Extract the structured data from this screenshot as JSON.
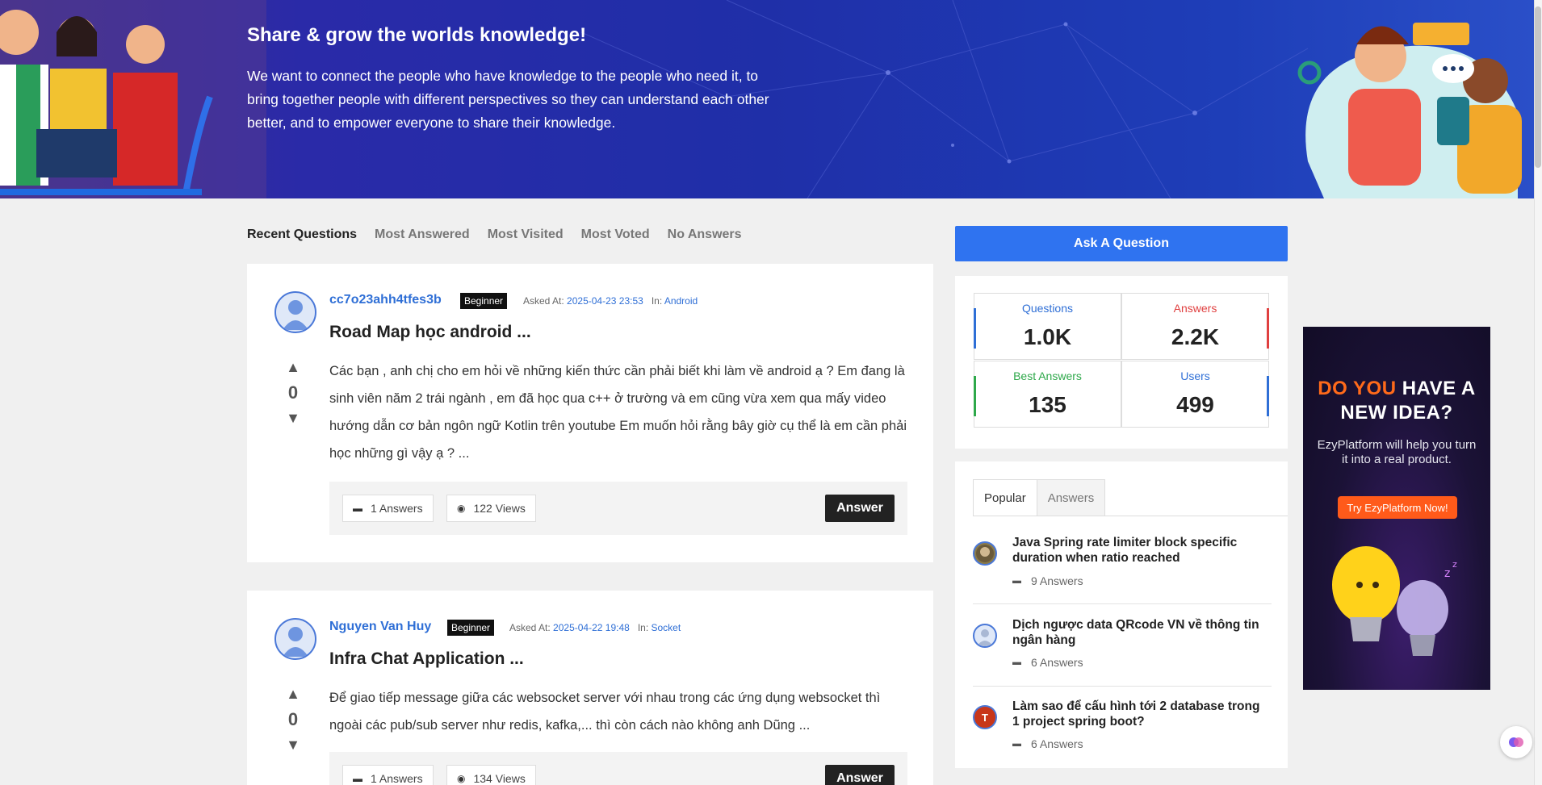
{
  "hero": {
    "title": "Share & grow the worlds knowledge!",
    "text": "We want to connect the people who have knowledge to the people who need it, to bring together people with different perspectives so they can understand each other better, and to empower everyone to share their knowledge."
  },
  "tabs": [
    "Recent Questions",
    "Most Answered",
    "Most Visited",
    "Most Voted",
    "No Answers"
  ],
  "questions": [
    {
      "author": "cc7o23ahh4tfes3b",
      "badge": "Beginner",
      "asked_label": "Asked At:",
      "asked_at": "2025-04-23 23:53",
      "in_label": "In:",
      "category": "Android",
      "title": "Road Map học android ...",
      "votes": "0",
      "body": "Các bạn , anh chị cho em hỏi về những kiến thức cần phải biết khi làm về android ạ ? Em đang là sinh viên năm 2 trái ngành , em đã học qua c++ ở trường và em cũng vừa xem qua mấy video hướng dẫn cơ bản ngôn ngữ Kotlin trên youtube Em muốn hỏi rằng bây giờ cụ thể là em cần phải học những gì vậy ạ ? ...",
      "answers": "1 Answers",
      "views": "122 Views",
      "answer_btn": "Answer"
    },
    {
      "author": "Nguyen Van Huy",
      "badge": "Beginner",
      "asked_label": "Asked At:",
      "asked_at": "2025-04-22 19:48",
      "in_label": "In:",
      "category": "Socket",
      "title": "Infra Chat Application ...",
      "votes": "0",
      "body": "Để giao tiếp message giữa các websocket server với nhau trong các ứng dụng websocket thì ngoài các pub/sub server như redis, kafka,... thì còn cách nào không anh Dũng ...",
      "answers": "1 Answers",
      "views": "134 Views",
      "answer_btn": "Answer"
    }
  ],
  "sidebar": {
    "ask_button": "Ask A Question",
    "stats": [
      {
        "label": "Questions",
        "value": "1.0K",
        "color": "#2f6fd6"
      },
      {
        "label": "Answers",
        "value": "2.2K",
        "color": "#e04040"
      },
      {
        "label": "Best Answers",
        "value": "135",
        "color": "#2ea84a"
      },
      {
        "label": "Users",
        "value": "499",
        "color": "#2f6fd6"
      }
    ],
    "tabs": [
      "Popular",
      "Answers"
    ],
    "popular": [
      {
        "title": "Java Spring rate limiter block specific duration when ratio reached",
        "answers": "9 Answers"
      },
      {
        "title": "Dịch ngược data QRcode VN về thông tin ngân hàng",
        "answers": "6 Answers"
      },
      {
        "title": "Làm sao để cấu hình tới 2 database trong 1 project spring boot?",
        "answers": "6 Answers",
        "avatar_letter": "T"
      }
    ]
  },
  "ad": {
    "headline_highlight": "DO YOU",
    "headline_rest": "HAVE A",
    "headline_line2": "NEW IDEA?",
    "sub": "EzyPlatform will help you turn it into a real product.",
    "cta": "Try EzyPlatform Now!"
  },
  "colors": {
    "accent": "#2f73f0",
    "link": "#2f6fd6",
    "ad_orange": "#ff5a1a"
  }
}
